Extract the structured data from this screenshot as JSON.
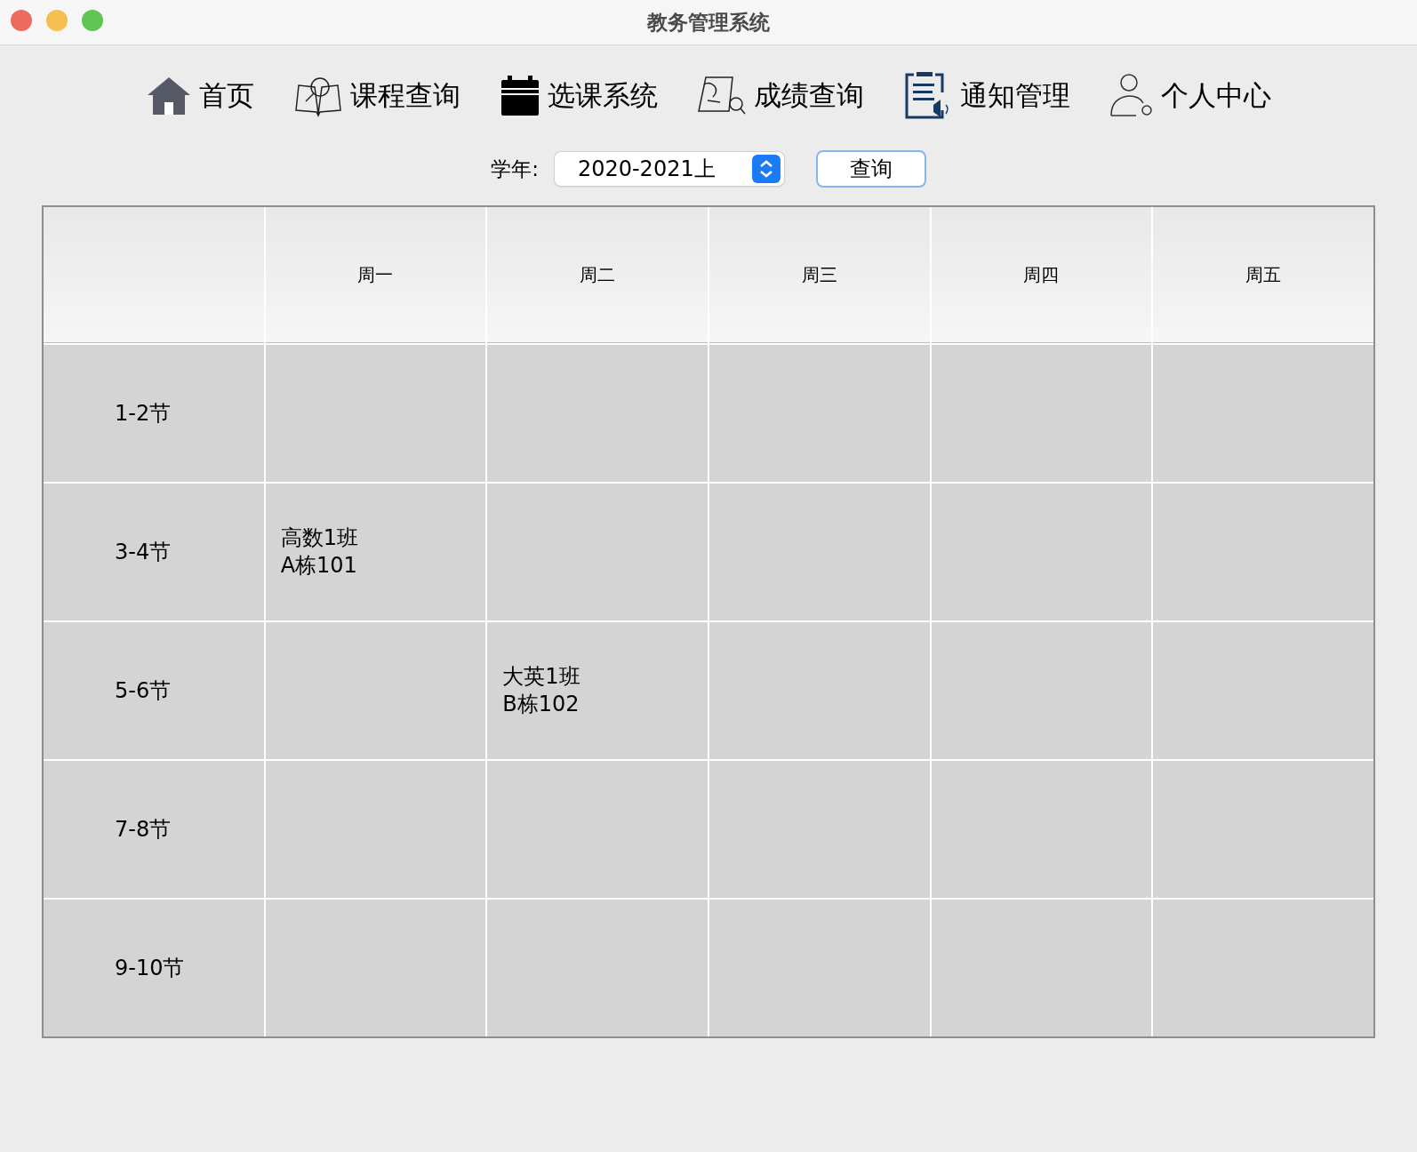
{
  "window": {
    "title": "教务管理系统"
  },
  "nav": [
    {
      "label": "首页"
    },
    {
      "label": "课程查询"
    },
    {
      "label": "选课系统"
    },
    {
      "label": "成绩查询"
    },
    {
      "label": "通知管理"
    },
    {
      "label": "个人中心"
    }
  ],
  "filter": {
    "label": "学年:",
    "value": "2020-2021上",
    "button": "查询"
  },
  "table": {
    "columns": [
      "周一",
      "周二",
      "周三",
      "周四",
      "周五"
    ],
    "rows": [
      {
        "label": "1-2节",
        "cells": [
          {},
          {},
          {},
          {},
          {}
        ]
      },
      {
        "label": "3-4节",
        "cells": [
          {
            "text": "高数1班\nA栋101"
          },
          {},
          {},
          {},
          {}
        ]
      },
      {
        "label": "5-6节",
        "cells": [
          {},
          {
            "text": "大英1班\nB栋102"
          },
          {},
          {},
          {}
        ]
      },
      {
        "label": "7-8节",
        "cells": [
          {},
          {},
          {},
          {},
          {}
        ]
      },
      {
        "label": "9-10节",
        "cells": [
          {},
          {},
          {},
          {},
          {}
        ]
      }
    ]
  }
}
